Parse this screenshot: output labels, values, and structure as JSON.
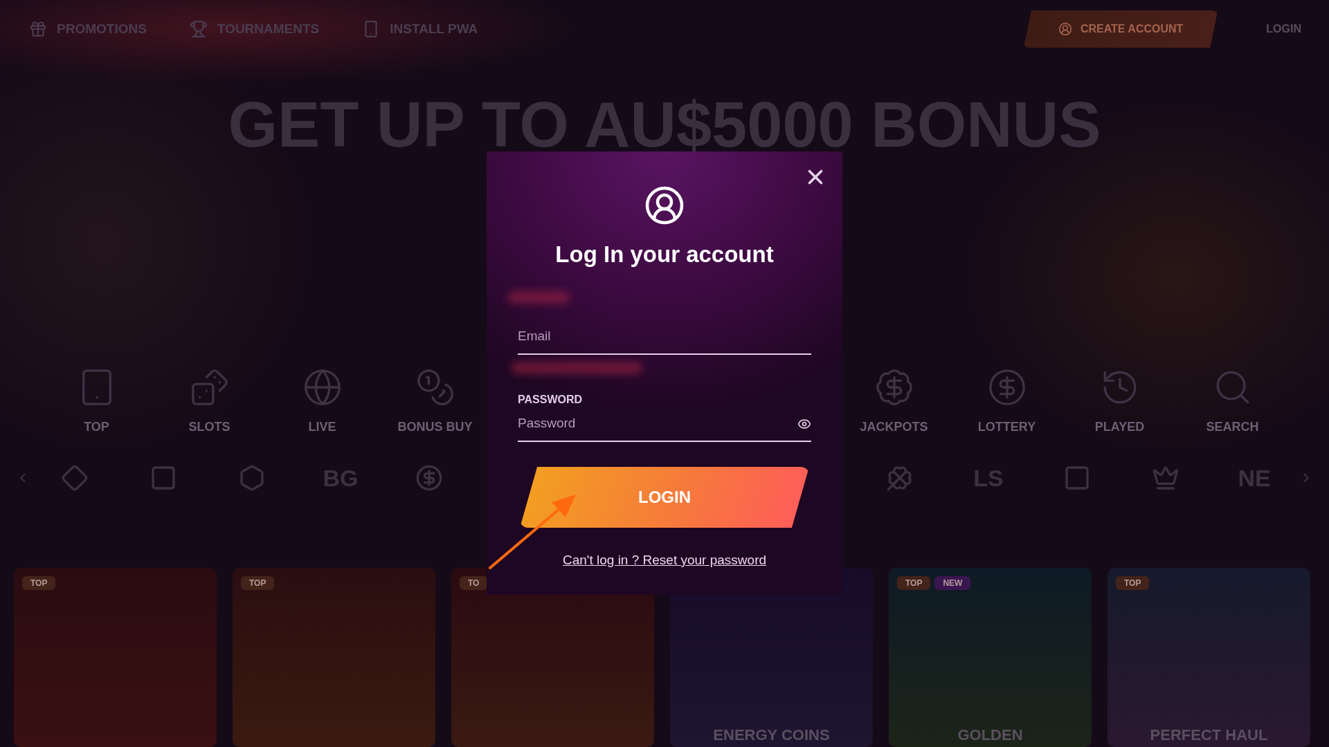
{
  "nav": {
    "items": [
      {
        "label": "PROMOTIONS"
      },
      {
        "label": "TOURNAMENTS"
      },
      {
        "label": "INSTALL PWA"
      }
    ],
    "create_account": "CREATE ACCOUNT",
    "login": "LOGIN"
  },
  "hero": {
    "headline": "GET UP TO AU$5000 BONUS"
  },
  "categories_left": [
    {
      "label": "TOP"
    },
    {
      "label": "SLOTS"
    },
    {
      "label": "LIVE"
    },
    {
      "label": "BONUS BUY"
    }
  ],
  "categories_right": [
    {
      "label": "JACKPOTS"
    },
    {
      "label": "LOTTERY"
    },
    {
      "label": "PLAYED"
    },
    {
      "label": "SEARCH"
    }
  ],
  "providers_left": [
    {
      "kind": "icon"
    },
    {
      "kind": "icon"
    },
    {
      "kind": "icon"
    },
    {
      "kind": "text",
      "text": "BG"
    },
    {
      "kind": "icon"
    }
  ],
  "providers_right": [
    {
      "kind": "icon"
    },
    {
      "kind": "text",
      "text": "LS"
    },
    {
      "kind": "icon"
    },
    {
      "kind": "icon"
    },
    {
      "kind": "text",
      "text": "NE"
    }
  ],
  "games": [
    {
      "badges": [
        {
          "kind": "top",
          "text": "TOP"
        }
      ]
    },
    {
      "badges": [
        {
          "kind": "top",
          "text": "TOP"
        }
      ]
    },
    {
      "badges": [
        {
          "kind": "top",
          "text": "TO"
        }
      ]
    },
    {
      "title": "ENERGY COINS"
    },
    {
      "badges": [
        {
          "kind": "top",
          "text": "TOP"
        },
        {
          "kind": "new",
          "text": "NEW"
        }
      ],
      "title": "GOLDEN"
    },
    {
      "badges": [
        {
          "kind": "top",
          "text": "TOP"
        }
      ],
      "title": "PERFECT HAUL"
    }
  ],
  "modal": {
    "title": "Log In your account",
    "fields": [
      {
        "kind": "email",
        "placeholder": "Email"
      },
      {
        "kind": "password",
        "label": "PASSWORD",
        "placeholder": "Password"
      }
    ],
    "button": "LOGIN",
    "link": "Can't log in ? Reset your password"
  }
}
